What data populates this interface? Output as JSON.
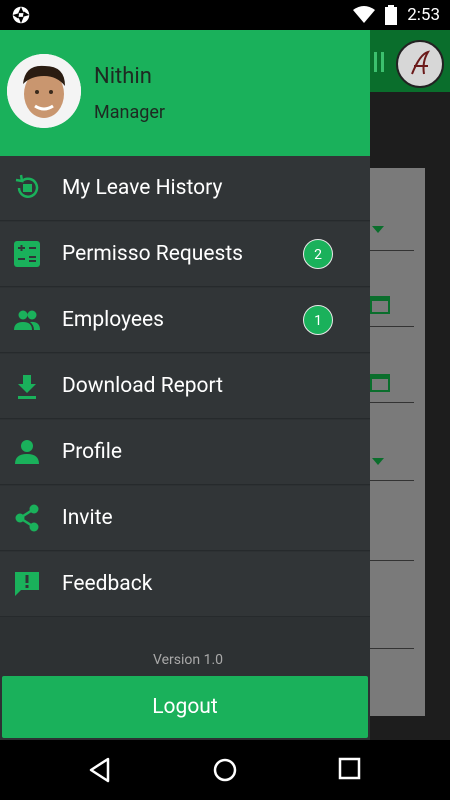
{
  "status_bar": {
    "time": "2:53"
  },
  "user": {
    "name": "Nithin",
    "role": "Manager"
  },
  "menu": {
    "items": [
      {
        "label": "My Leave History",
        "icon": "leave-history-icon"
      },
      {
        "label": "Permisso Requests",
        "icon": "calculator-icon",
        "badge": "2"
      },
      {
        "label": "Employees",
        "icon": "people-icon",
        "badge": "1"
      },
      {
        "label": "Download Report",
        "icon": "download-icon"
      },
      {
        "label": "Profile",
        "icon": "person-icon"
      },
      {
        "label": "Invite",
        "icon": "share-icon"
      },
      {
        "label": "Feedback",
        "icon": "feedback-icon"
      }
    ]
  },
  "footer": {
    "version": "Version 1.0",
    "logout_label": "Logout"
  },
  "colors": {
    "accent": "#1ab15b",
    "drawer_bg": "#2d3133",
    "item_bg": "#313537"
  }
}
